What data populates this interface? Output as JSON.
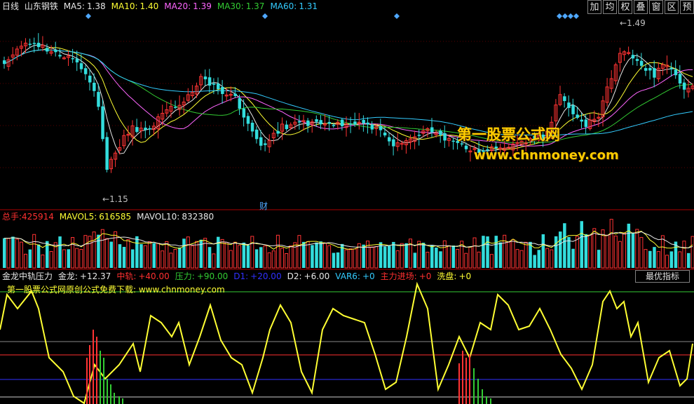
{
  "topbar": {
    "period": "日线",
    "stock_name": "山东钢铁",
    "ma": [
      {
        "label": "MA5:",
        "value": "1.38",
        "color": "#e8e8e8"
      },
      {
        "label": "MA10:",
        "value": "1.40",
        "color": "#ffff33"
      },
      {
        "label": "MA20:",
        "value": "1.39",
        "color": "#ff66ff"
      },
      {
        "label": "MA30:",
        "value": "1.37",
        "color": "#33cc33"
      },
      {
        "label": "MA60:",
        "value": "1.31",
        "color": "#33ccff"
      }
    ]
  },
  "toolbar_buttons": [
    "加",
    "均",
    "权",
    "叠",
    "窗",
    "区",
    "预"
  ],
  "price_panel": {
    "high_label": "1.49",
    "low_label": "1.15",
    "finance_marker": "财"
  },
  "watermark": {
    "line1": "第一股票公式网",
    "line2": "www.chnmoney.com"
  },
  "volume_bar": {
    "title": "总手:",
    "value": "425914",
    "items": [
      {
        "label": "MAVOL5:",
        "value": "616585",
        "color": "#ffff33"
      },
      {
        "label": "MAVOL10:",
        "value": "832380",
        "color": "#e8e8e8"
      }
    ]
  },
  "indicator_bar": {
    "title": "金龙中轨压力",
    "items": [
      {
        "label": "金龙:",
        "value": "+12.37",
        "color": "#e8e8e8"
      },
      {
        "label": "中轨:",
        "value": "+40.00",
        "color": "#ff3030"
      },
      {
        "label": "压力:",
        "value": "+90.00",
        "color": "#33cc33"
      },
      {
        "label": "D1:",
        "value": "+20.00",
        "color": "#3030ff"
      },
      {
        "label": "D2:",
        "value": "+6.00",
        "color": "#e8e8e8"
      },
      {
        "label": "VAR6:",
        "value": "+0",
        "color": "#33ccff"
      },
      {
        "label": "主力进场:",
        "value": "+0",
        "color": "#ff3030"
      },
      {
        "label": "洗盘:",
        "value": "+0",
        "color": "#ffff33"
      }
    ],
    "best_button": "最优指标"
  },
  "site_note": "第一股票公式网原创公式免费下载: www.chnmoney.com",
  "colors": {
    "up": "#ff3333",
    "down": "#33dddd",
    "background": "#000000",
    "divider": "#aa0000"
  }
}
